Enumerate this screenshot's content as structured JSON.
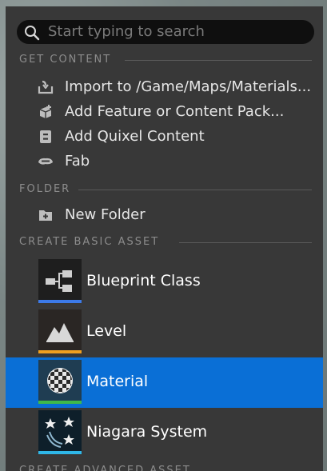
{
  "search": {
    "placeholder": "Start typing to search"
  },
  "sections": {
    "get_content": "GET CONTENT",
    "folder": "FOLDER",
    "create_basic_asset": "CREATE BASIC ASSET",
    "create_advanced_asset": "CREATE ADVANCED ASSET"
  },
  "get_content_items": [
    {
      "label": "Import to /Game/Maps/Materials...",
      "icon": "import-icon"
    },
    {
      "label": "Add Feature or Content Pack...",
      "icon": "feature-pack-icon"
    },
    {
      "label": "Add Quixel Content",
      "icon": "quixel-icon"
    },
    {
      "label": "Fab",
      "icon": "fab-icon"
    }
  ],
  "folder_items": [
    {
      "label": "New Folder",
      "icon": "new-folder-icon"
    }
  ],
  "basic_assets": [
    {
      "label": "Blueprint Class",
      "icon": "blueprint-icon",
      "accent": "#3c7ae8"
    },
    {
      "label": "Level",
      "icon": "level-icon",
      "accent": "#f0a020"
    },
    {
      "label": "Material",
      "icon": "material-icon",
      "accent": "#3fb94a",
      "selected": true
    },
    {
      "label": "Niagara System",
      "icon": "niagara-icon",
      "accent": "#2fb7e8"
    }
  ],
  "colors": {
    "menu_bg": "#383838",
    "selection": "#0a6fd6",
    "text": "#e6e6e6",
    "section_text": "#8c8c8c"
  }
}
